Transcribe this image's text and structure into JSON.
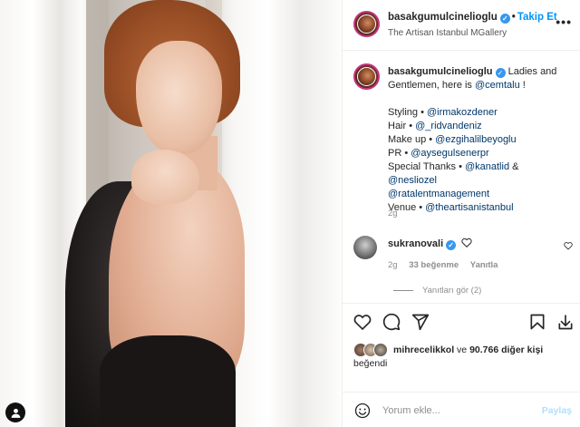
{
  "post": {
    "username": "basakgumulcinelioglu",
    "follow_label": "Takip Et",
    "location": "The Artisan Istanbul MGallery",
    "more_label": "•••"
  },
  "caption": {
    "username": "basakgumulcinelioglu",
    "text_before": "Ladies and Gentlemen, here is",
    "mention": "@cemtalu",
    "text_after": "!",
    "credits": [
      {
        "label": "Styling •",
        "tag": "@irmakozdener"
      },
      {
        "label": "Hair •",
        "tag": "@_ridvandeniz"
      },
      {
        "label": "Make up •",
        "tag": "@ezgihalilbeyoglu"
      },
      {
        "label": "PR •",
        "tag": "@aysegulsenerpr"
      }
    ],
    "special_label": "Special Thanks •",
    "special_tag1": "@kanatlid",
    "special_amp": "&",
    "special_tag2": "@nesliozel",
    "special_tag3": "@ratalentmanagement",
    "venue_label": "Venue •",
    "venue_tag": "@theartisanistanbul",
    "time": "2g"
  },
  "comment": {
    "username": "sukranovali",
    "time": "2g",
    "likes": "33 beğenme",
    "reply_label": "Yanıtla",
    "view_replies": "Yanıtları gör (2)"
  },
  "likes": {
    "first_user": "mihrecelikkol",
    "connector": "ve",
    "others": "90.766 diğer kişi",
    "suffix": "beğendi"
  },
  "comment_bar": {
    "placeholder": "Yorum ekle...",
    "post_label": "Paylaş"
  },
  "colors": {
    "link": "#00376b",
    "accent": "#0095f6",
    "verified": "#3897f0",
    "muted": "#8e8e8e"
  },
  "icons": [
    "user-icon",
    "more-icon",
    "verified-icon",
    "heart-icon",
    "comment-icon",
    "share-icon",
    "save-icon",
    "download-icon",
    "emoji-icon"
  ]
}
